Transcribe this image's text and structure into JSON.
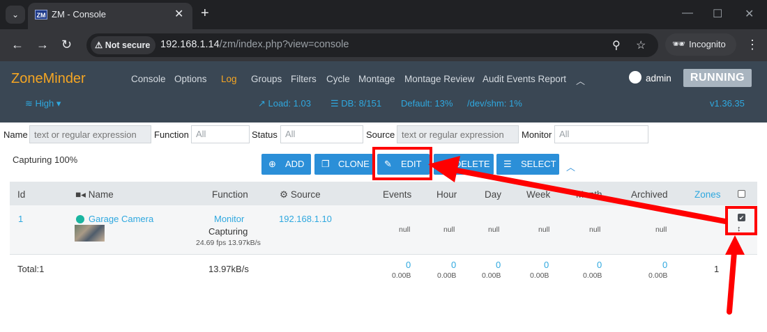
{
  "browser": {
    "tab_title": "ZM - Console",
    "tab_favicon_text": "ZM",
    "security_label": "Not secure",
    "url_host": "192.168.1.14",
    "url_path": "/zm/index.php?view=console",
    "incognito_label": "Incognito"
  },
  "header": {
    "brand": "ZoneMinder",
    "menu": [
      "Console",
      "Options",
      "Log",
      "Groups",
      "Filters",
      "Cycle",
      "Montage",
      "Montage Review",
      "Audit Events Report"
    ],
    "active_menu": "Log",
    "user": "admin",
    "state": "RUNNING",
    "bandwidth": "High",
    "load": "Load: 1.03",
    "db": "DB: 8/151",
    "default_disk": "Default: 13%",
    "shm": "/dev/shm: 1%",
    "version": "v1.36.35"
  },
  "filters": {
    "name_label": "Name",
    "name_placeholder": "text or regular expression",
    "function_label": "Function",
    "function_value": "All",
    "status_label": "Status",
    "status_value": "All",
    "source_label": "Source",
    "source_placeholder": "text or regular expression",
    "monitor_label": "Monitor",
    "monitor_value": "All"
  },
  "capturing_text": "Capturing 100%",
  "actions": {
    "add": "ADD",
    "clone": "CLONE",
    "edit": "EDIT",
    "delete": "DELETE",
    "select": "SELECT"
  },
  "table": {
    "headers": {
      "id": "Id",
      "name": "Name",
      "function": "Function",
      "source": "Source",
      "events": "Events",
      "hour": "Hour",
      "day": "Day",
      "week": "Week",
      "month": "Month",
      "archived": "Archived",
      "zones": "Zones"
    },
    "row": {
      "id": "1",
      "name": "Garage Camera",
      "function": "Monitor",
      "status": "Capturing",
      "rate": "24.69 fps 13.97kB/s",
      "source": "192.168.1.10",
      "events": "null",
      "hour": "null",
      "day": "null",
      "week": "null",
      "month": "null",
      "archived": "null",
      "selected": true
    },
    "totals": {
      "label": "Total:1",
      "bandwidth": "13.97kB/s",
      "events": "0",
      "events_size": "0.00B",
      "hour": "0",
      "hour_size": "0.00B",
      "day": "0",
      "day_size": "0.00B",
      "week": "0",
      "week_size": "0.00B",
      "month": "0",
      "month_size": "0.00B",
      "archived": "0",
      "archived_size": "0.00B",
      "zones": "1"
    }
  },
  "colors": {
    "header_bg": "#3a4754",
    "brand": "#f5a623",
    "accent": "#2b8fd8",
    "annotation": "#ff0000"
  }
}
